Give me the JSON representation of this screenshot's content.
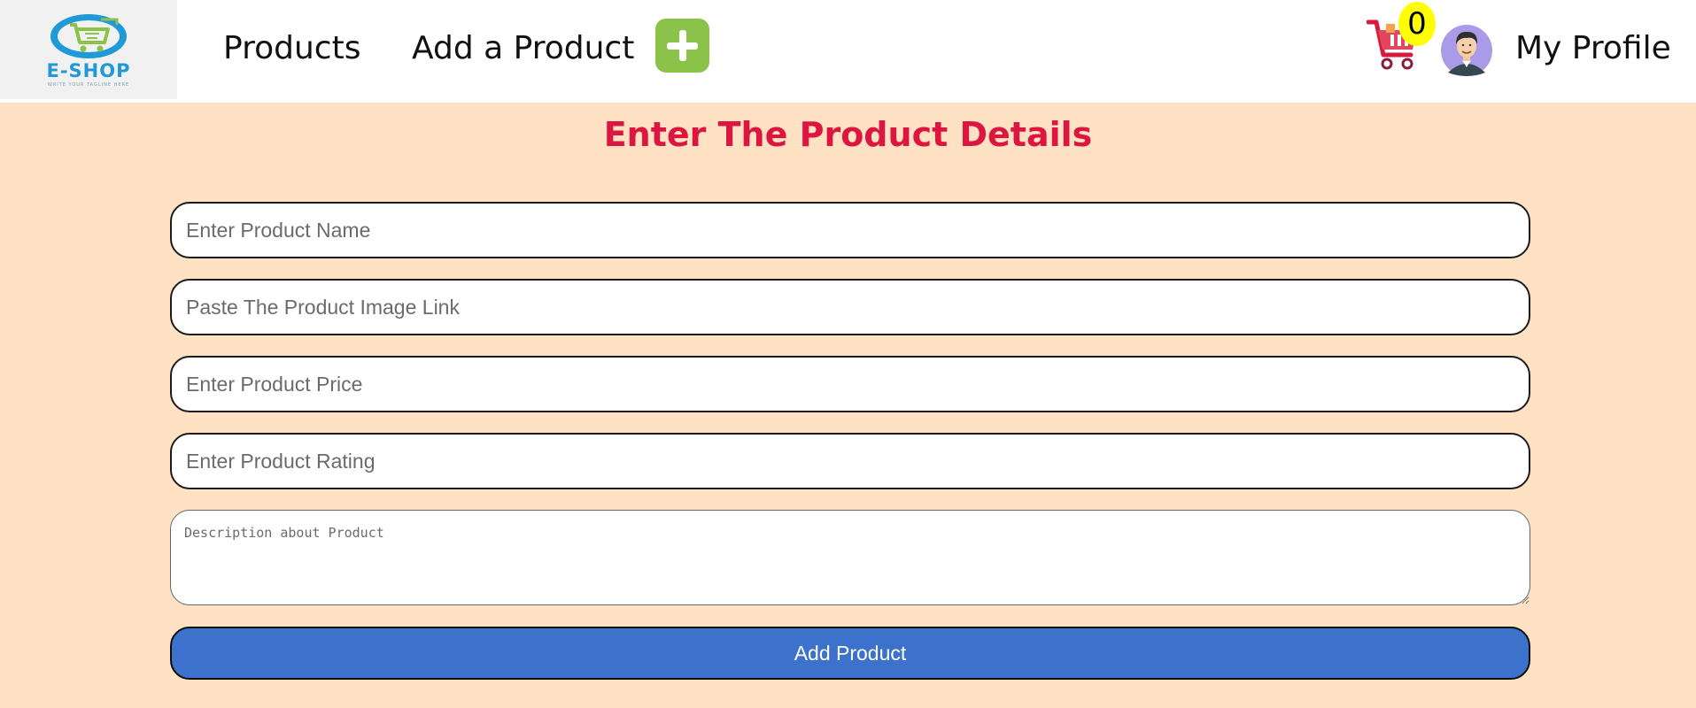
{
  "brand": {
    "name": "E-SHOP",
    "tagline": "WRITE YOUR TAGLINE HERE"
  },
  "nav": {
    "products_label": "Products",
    "add_product_label": "Add a Product",
    "add_icon": "plus-icon",
    "cart_icon": "shopping-cart-icon",
    "cart_count": "0",
    "profile_label": "My Profile",
    "avatar_icon": "user-avatar-icon"
  },
  "form": {
    "title": "Enter The Product Details",
    "name_placeholder": "Enter Product Name",
    "image_placeholder": "Paste The Product Image Link",
    "price_placeholder": "Enter Product Price",
    "rating_placeholder": "Enter Product Rating",
    "description_placeholder": "Description about Product",
    "submit_label": "Add Product"
  },
  "colors": {
    "form_background": "#ffe2c3",
    "title": "#dc1640",
    "submit_button": "#3c71cc",
    "add_icon": "#8bc34a",
    "cart_badge": "#ffff00",
    "cart": "#d81b3c"
  }
}
